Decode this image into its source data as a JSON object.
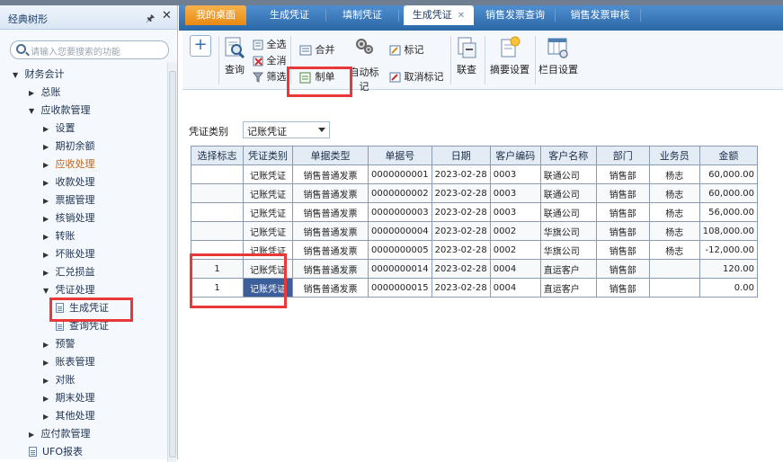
{
  "left_panel": {
    "title": "经典树形",
    "pin_glyph": "🖈",
    "close_glyph": "✕",
    "search_placeholder": "请输入您要搜索的功能",
    "tree": [
      {
        "label": "财务会计",
        "arrow": "▼",
        "level": 0
      },
      {
        "label": "总账",
        "arrow": "▶",
        "level": 1
      },
      {
        "label": "应收款管理",
        "arrow": "▼",
        "level": 1
      },
      {
        "label": "设置",
        "arrow": "▶",
        "level": 2
      },
      {
        "label": "期初余额",
        "arrow": "▶",
        "level": 2
      },
      {
        "label": "应收处理",
        "arrow": "▶",
        "level": 2,
        "active": true
      },
      {
        "label": "收款处理",
        "arrow": "▶",
        "level": 2
      },
      {
        "label": "票据管理",
        "arrow": "▶",
        "level": 2
      },
      {
        "label": "核销处理",
        "arrow": "▶",
        "level": 2
      },
      {
        "label": "转账",
        "arrow": "▶",
        "level": 2
      },
      {
        "label": "坏账处理",
        "arrow": "▶",
        "level": 2
      },
      {
        "label": "汇兑损益",
        "arrow": "▶",
        "level": 2
      },
      {
        "label": "凭证处理",
        "arrow": "▼",
        "level": 2
      },
      {
        "label": "生成凭证",
        "arrow": "",
        "level": 3,
        "doc": true
      },
      {
        "label": "查询凭证",
        "arrow": "",
        "level": 3,
        "doc": true
      },
      {
        "label": "预警",
        "arrow": "▶",
        "level": 2
      },
      {
        "label": "账表管理",
        "arrow": "▶",
        "level": 2
      },
      {
        "label": "对账",
        "arrow": "▶",
        "level": 2
      },
      {
        "label": "期末处理",
        "arrow": "▶",
        "level": 2
      },
      {
        "label": "其他处理",
        "arrow": "▶",
        "level": 2
      },
      {
        "label": "应付款管理",
        "arrow": "▶",
        "level": 1
      },
      {
        "label": "UFO报表",
        "arrow": "",
        "level": 1,
        "doc": true
      }
    ]
  },
  "tabs": [
    {
      "label": "我的桌面",
      "type": "home"
    },
    {
      "label": "生成凭证"
    },
    {
      "label": "填制凭证"
    },
    {
      "label": "生成凭证",
      "type": "active",
      "close": "✕"
    },
    {
      "label": "销售发票查询"
    },
    {
      "label": "销售发票审核"
    }
  ],
  "toolbar": {
    "add_glyph": "+",
    "query": "查询",
    "select_all": "全选",
    "deselect_all": "全消",
    "filter": "筛选",
    "merge": "合并",
    "make_voucher": "制单",
    "auto_mark": "自动标记",
    "mark": "标记",
    "cancel_mark": "取消标记",
    "link_query": "联查",
    "summary_settings": "摘要设置",
    "column_settings": "栏目设置"
  },
  "voucher_type": {
    "label": "凭证类别",
    "value": "记账凭证"
  },
  "table": {
    "headers": [
      "选择标志",
      "凭证类别",
      "单据类型",
      "单据号",
      "日期",
      "客户编码",
      "客户名称",
      "部门",
      "业务员",
      "金额"
    ],
    "rows": [
      [
        "",
        "记账凭证",
        "销售普通发票",
        "0000000001",
        "2023-02-28",
        "0003",
        "联通公司",
        "销售部",
        "杨志",
        "60,000.00"
      ],
      [
        "",
        "记账凭证",
        "销售普通发票",
        "0000000002",
        "2023-02-28",
        "0003",
        "联通公司",
        "销售部",
        "杨志",
        "60,000.00"
      ],
      [
        "",
        "记账凭证",
        "销售普通发票",
        "0000000003",
        "2023-02-28",
        "0003",
        "联通公司",
        "销售部",
        "杨志",
        "56,000.00"
      ],
      [
        "",
        "记账凭证",
        "销售普通发票",
        "0000000004",
        "2023-02-28",
        "0002",
        "华旗公司",
        "销售部",
        "杨志",
        "108,000.00"
      ],
      [
        "",
        "记账凭证",
        "销售普通发票",
        "0000000005",
        "2023-02-28",
        "0002",
        "华旗公司",
        "销售部",
        "杨志",
        "-12,000.00"
      ],
      [
        "1",
        "记账凭证",
        "销售普通发票",
        "0000000014",
        "2023-02-28",
        "0004",
        "直运客户",
        "销售部",
        "",
        "120.00"
      ],
      [
        "1",
        "记账凭证",
        "销售普通发票",
        "0000000015",
        "2023-02-28",
        "0004",
        "直运客户",
        "销售部",
        "",
        "0.00"
      ]
    ]
  },
  "colors": {
    "highlight": "#e8383a",
    "tab_bar": "#2f6fae",
    "home_tab": "#f0a030",
    "selected_cell": "#3c5e9a"
  }
}
